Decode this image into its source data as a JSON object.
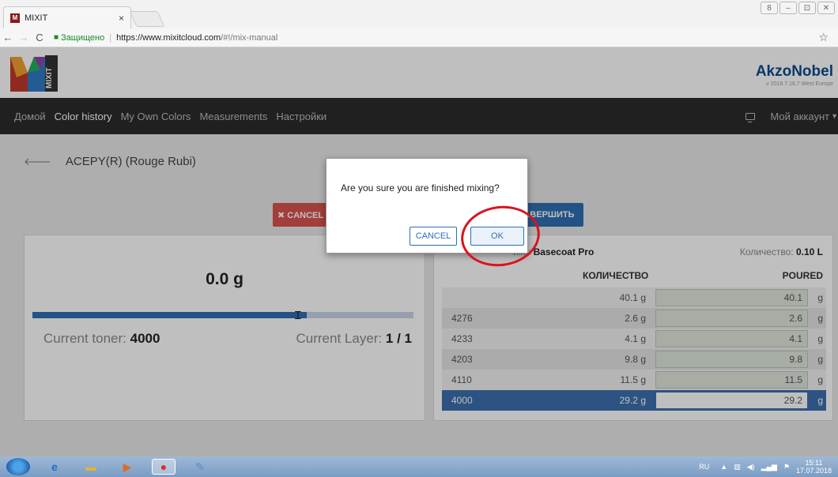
{
  "browser": {
    "tab_title": "MIXIT",
    "tab_favicon_letter": "M",
    "tab_close": "×",
    "secure_label": "Защищено",
    "url_host": "https://www.mixitcloud.com",
    "url_path": "/#!/mix-manual",
    "star": "☆"
  },
  "window_controls": [
    "8",
    "–",
    "⊡",
    "✕"
  ],
  "header": {
    "logo_text": "MIXIT",
    "brand_name": "AkzoNobel",
    "brand_version": "v 2018.7.16.7 West Europe"
  },
  "nav": {
    "items": [
      {
        "label": "Домой",
        "active": false
      },
      {
        "label": "Color history",
        "active": true
      },
      {
        "label": "My Own Colors",
        "active": false
      },
      {
        "label": "Measurements",
        "active": false
      },
      {
        "label": "Настройки",
        "active": false
      }
    ],
    "account_label": "Мой аккаунт"
  },
  "breadcrumb": {
    "title": "ACEPY(R) (Rouge Rubi)"
  },
  "actions": {
    "cancel_label": "✖ CANCEL",
    "finish_label": "ЗАВЕРШИТЬ"
  },
  "left_panel": {
    "weight": "0.0 g",
    "progress_fraction": 0.72,
    "current_toner_label": "Current toner:",
    "current_toner_value": "4000",
    "current_layer_label": "Current Layer:",
    "current_layer_value": "1 / 1"
  },
  "right_panel": {
    "product_label": "йка:",
    "product_value": "Basecoat Pro",
    "quantity_label": "Количество:",
    "quantity_value": "0.10 L",
    "col_quantity": "КОЛИЧЕСТВО",
    "col_poured": "POURED",
    "rows": [
      {
        "code": "",
        "amount": "40.1 g",
        "poured": "40.1",
        "unit": "g",
        "active": false
      },
      {
        "code": "4276",
        "amount": "2.6 g",
        "poured": "2.6",
        "unit": "g",
        "active": false
      },
      {
        "code": "4233",
        "amount": "4.1 g",
        "poured": "4.1",
        "unit": "g",
        "active": false
      },
      {
        "code": "4203",
        "amount": "9.8 g",
        "poured": "9.8",
        "unit": "g",
        "active": false
      },
      {
        "code": "4110",
        "amount": "11.5 g",
        "poured": "11.5",
        "unit": "g",
        "active": false
      },
      {
        "code": "4000",
        "amount": "29.2 g",
        "poured": "29.2",
        "unit": "g",
        "active": true
      }
    ]
  },
  "modal": {
    "message": "Are you sure you are finished mixing?",
    "cancel_label": "CANCEL",
    "ok_label": "OK",
    "highlight_color": "#d9141e"
  },
  "taskbar": {
    "lang": "RU",
    "time": "15:11",
    "date": "17.07.2018"
  }
}
